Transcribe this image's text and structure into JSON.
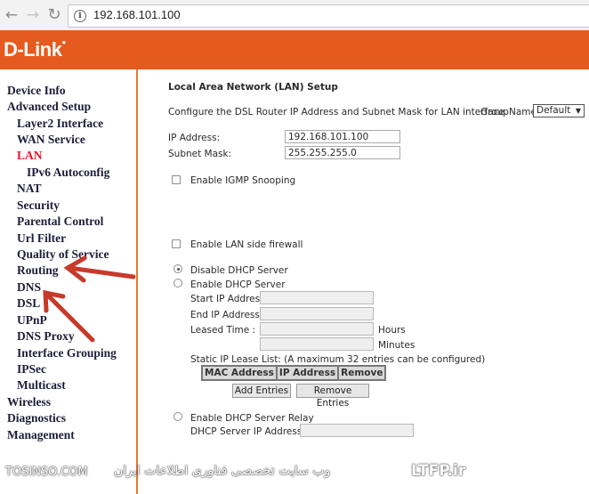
{
  "browser": {
    "url": "192.168.101.100",
    "back_icon": "back-arrow-icon",
    "forward_icon": "forward-arrow-icon",
    "reload_icon": "reload-icon"
  },
  "banner": {
    "logo": "D-Link",
    "color": "#e55a1e"
  },
  "sidebar": {
    "items": [
      {
        "label": "Device Info"
      },
      {
        "label": "Advanced Setup"
      },
      {
        "label": "Layer2 Interface"
      },
      {
        "label": "WAN Service"
      },
      {
        "label": "LAN"
      },
      {
        "label": "IPv6 Autoconfig"
      },
      {
        "label": "NAT"
      },
      {
        "label": "Security"
      },
      {
        "label": "Parental Control"
      },
      {
        "label": "Url Filter"
      },
      {
        "label": "Quality of Service"
      },
      {
        "label": "Routing"
      },
      {
        "label": "DNS"
      },
      {
        "label": "DSL"
      },
      {
        "label": "UPnP"
      },
      {
        "label": "DNS Proxy"
      },
      {
        "label": "Interface Grouping"
      },
      {
        "label": "IPSec"
      },
      {
        "label": "Multicast"
      },
      {
        "label": "Wireless"
      },
      {
        "label": "Diagnostics"
      },
      {
        "label": "Management"
      }
    ],
    "active": "LAN",
    "active_color": "#e8132a"
  },
  "content": {
    "title": "Local Area Network (LAN) Setup",
    "description": "Configure the DSL Router IP Address and Subnet Mask for LAN interface.",
    "group_name_label": "GroupName",
    "group_name_value": "Default",
    "ip_label": "IP Address:",
    "ip_value": "192.168.101.100",
    "subnet_label": "Subnet Mask:",
    "subnet_value": "255.255.255.0",
    "igmp_label": "Enable IGMP Snooping",
    "firewall_label": "Enable LAN side firewall",
    "dhcp_disable_label": "Disable DHCP Server",
    "dhcp_enable_label": "Enable DHCP Server",
    "start_ip_label": "Start IP Address:",
    "end_ip_label": "End IP Address:",
    "lease_label": "Leased Time :",
    "hours_label": "Hours",
    "minutes_label": "Minutes",
    "lease_list_label": "Static IP Lease List: (A maximum 32 entries can be configured)",
    "table_headers": [
      "MAC Address",
      "IP Address",
      "Remove"
    ],
    "add_button": "Add Entries",
    "remove_button": "Remove Entries",
    "relay_label": "Enable DHCP Server Relay",
    "relay_ip_label": "DHCP Server IP Address:"
  },
  "watermark": {
    "left": "TOSINSO.COM",
    "right": "LTFP.ir",
    "right_fa": "وب سایت تخصصی فناوری اطلاعات ایران"
  }
}
